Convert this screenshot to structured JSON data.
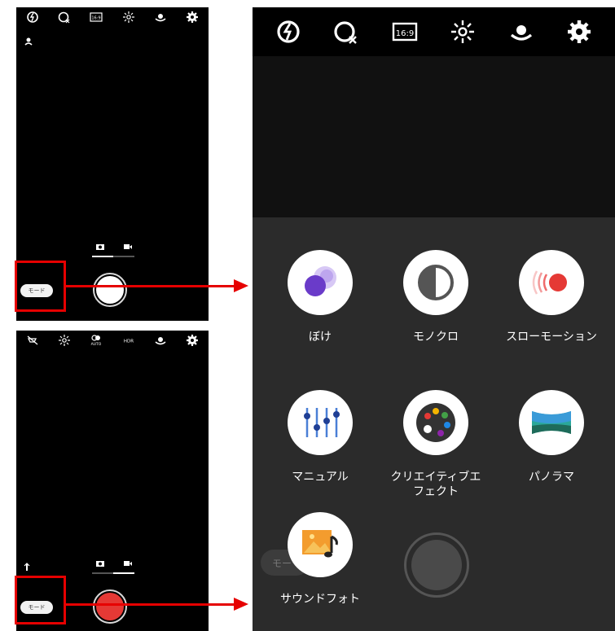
{
  "phone_photo": {
    "top_icons": [
      "flash-off-icon",
      "timer-off-icon",
      "aspect-ratio-icon",
      "brightness-icon",
      "switch-camera-icon",
      "settings-icon"
    ],
    "aspect_label": "16:9",
    "side_icon": "face-icon",
    "mode_button": "モード",
    "shutter_color": "#ffffff"
  },
  "phone_video": {
    "top_icons": [
      "light-off-icon",
      "brightness-icon",
      "hdr-auto-icon",
      "hdr-icon",
      "switch-camera-icon",
      "settings-icon"
    ],
    "hdr_label": "AUTO",
    "hdr_text": "HDR",
    "side_icon": "mic-icon",
    "mode_button": "モード",
    "shutter_color": "#e53935"
  },
  "mode_screen": {
    "top_icons": [
      "flash-off-icon",
      "timer-off-icon",
      "aspect-ratio-icon",
      "brightness-icon",
      "switch-camera-icon",
      "settings-icon"
    ],
    "aspect_label": "16:9",
    "modes": [
      {
        "label": "ぼけ",
        "icon": "bokeh-icon"
      },
      {
        "label": "モノクロ",
        "icon": "monochrome-icon"
      },
      {
        "label": "スローモーション",
        "icon": "slow-motion-icon"
      },
      {
        "label": "マニュアル",
        "icon": "manual-sliders-icon"
      },
      {
        "label": "クリエイティブエフェクト",
        "icon": "palette-icon"
      },
      {
        "label": "パノラマ",
        "icon": "panorama-icon"
      },
      {
        "label": "サウンドフォト",
        "icon": "sound-photo-icon"
      }
    ],
    "mode_button_ghost": "モー"
  },
  "annotation_color": "#e60000"
}
